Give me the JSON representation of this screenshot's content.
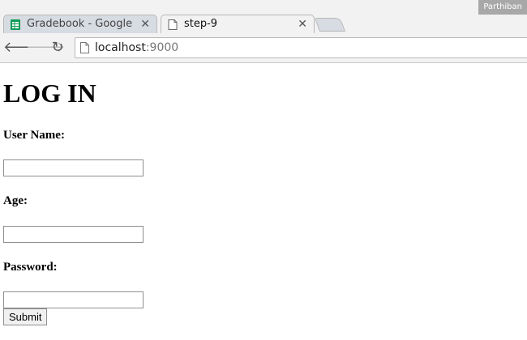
{
  "browser": {
    "profile_name": "Parthiban",
    "tabs": [
      {
        "title": "Gradebook - Google",
        "favicon": "sheets-icon",
        "active": false
      },
      {
        "title": "step-9",
        "favicon": "page-icon",
        "active": true
      }
    ],
    "url_host": "localhost",
    "url_port": ":9000",
    "colors": {
      "sheets_green": "#0f9d58"
    }
  },
  "page": {
    "heading": "LOG IN",
    "fields": [
      {
        "label": "User Name:",
        "value": "",
        "type": "text"
      },
      {
        "label": "Age:",
        "value": "",
        "type": "text"
      },
      {
        "label": "Password:",
        "value": "",
        "type": "password"
      }
    ],
    "submit_label": "Submit"
  }
}
